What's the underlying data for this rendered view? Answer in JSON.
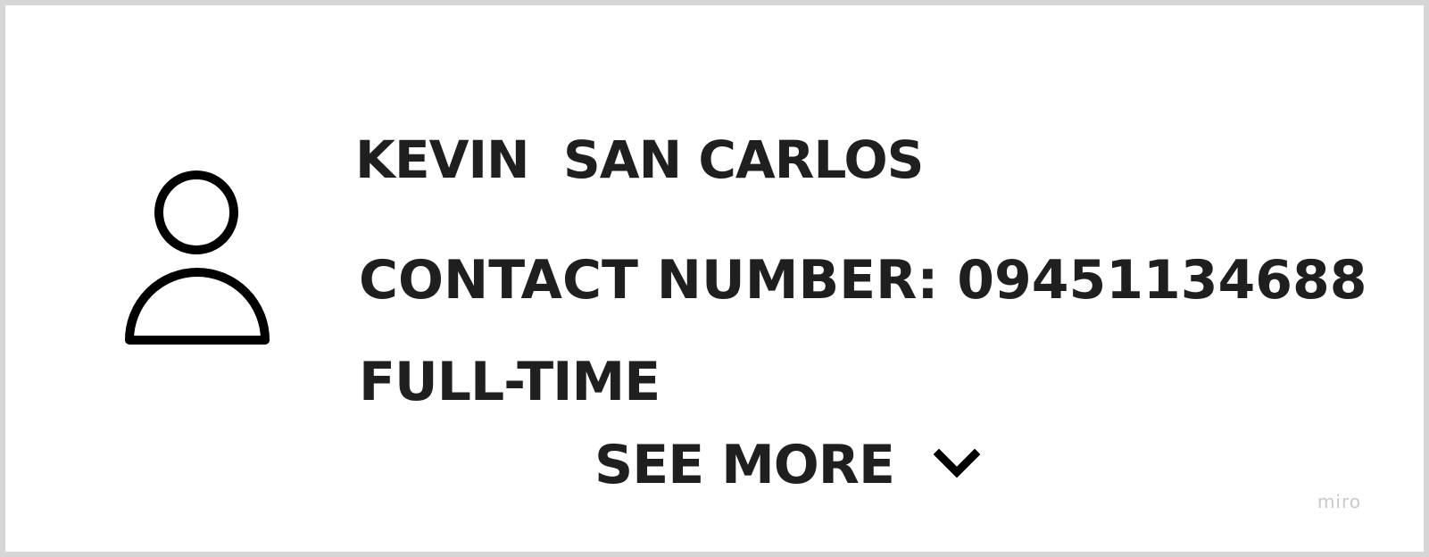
{
  "profile": {
    "avatar_icon": "user-icon",
    "name": "KEVIN  SAN CARLOS",
    "contact": "CONTACT NUMBER: 09451134688",
    "status": "FULL-TIME"
  },
  "actions": {
    "see_more_label": "SEE MORE",
    "see_more_icon": "chevron-down-icon"
  },
  "watermark": "miro",
  "colors": {
    "text": "#1f1f1f",
    "border": "#d6d6d6",
    "watermark": "#c9c9c9"
  }
}
